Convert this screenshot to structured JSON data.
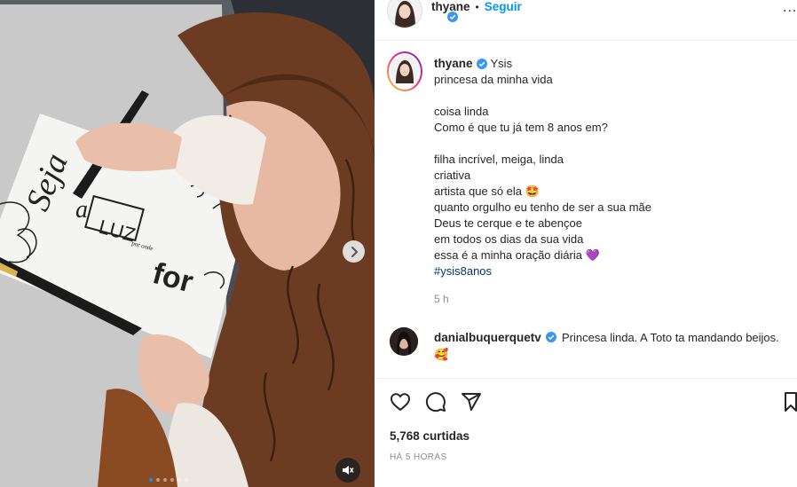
{
  "post": {
    "author": "thyane",
    "follow_label": "Seguir",
    "more_label": "...",
    "caption_tag": "Ysis",
    "caption_lines": [
      "princesa da minha vida",
      "",
      "coisa linda",
      "Como é que tu já tem 8 anos em?",
      "",
      "filha incrível, meiga, linda",
      "criativa",
      "artista que só ela 🤩",
      "quanto orgulho eu tenho de ser a sua mãe",
      "Deus te cerque e te abençoe",
      "em todos os dias da sua vida",
      "essa é a minha oração diária 💜"
    ],
    "hashtag": "#ysis8anos",
    "caption_time": "5 h"
  },
  "comment": {
    "username": "danialbuquerquetv",
    "text": "Princesa linda. A Toto ta mandando beijos. 🥰"
  },
  "footer": {
    "likes": "5,768 curtidas",
    "time_ago": "HÁ 5 HORAS"
  },
  "media": {
    "carousel_slides": 6,
    "active_slide": 1,
    "drawing_text": {
      "top": "Seja",
      "middle": "a",
      "box": "LUZ",
      "small": "por onde",
      "bottom": "for"
    }
  },
  "icons": {
    "like": "heart-icon",
    "comment": "comment-icon",
    "share": "send-icon",
    "save": "bookmark-icon",
    "next": "chevron-right-icon",
    "mute": "muted-speaker-icon",
    "verified": "verified-badge-icon"
  },
  "colors": {
    "link_blue": "#0095f6",
    "hashtag": "#00376b",
    "muted_text": "#8e8e8e",
    "verified": "#3897f0"
  }
}
